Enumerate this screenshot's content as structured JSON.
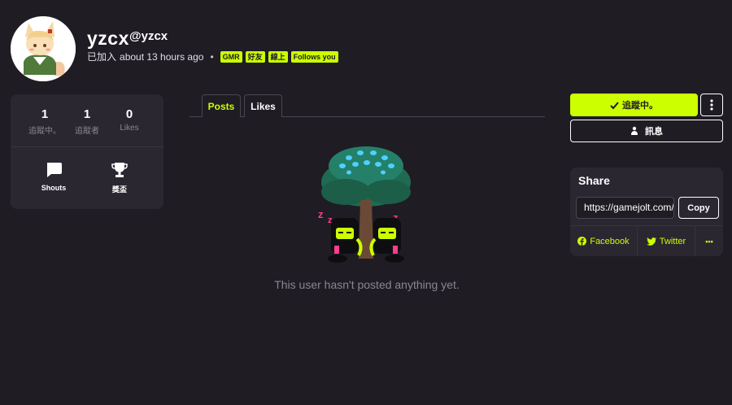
{
  "profile": {
    "name": "yzcx",
    "handle": "@yzcx",
    "joined_label": "已加入",
    "joined_time": "about 13 hours ago",
    "separator": "•",
    "tags": [
      "GMR",
      "好友",
      "線上",
      "Follows you"
    ]
  },
  "stats": {
    "items": [
      {
        "value": "1",
        "label": "追蹤中。"
      },
      {
        "value": "1",
        "label": "追蹤者"
      },
      {
        "value": "0",
        "label": "Likes"
      }
    ],
    "links": [
      {
        "label": "Shouts",
        "icon": "chat-bubble-icon"
      },
      {
        "label": "獎盃",
        "icon": "trophy-icon"
      }
    ]
  },
  "tabs": [
    {
      "label": "Posts",
      "active": true
    },
    {
      "label": "Likes",
      "active": false
    }
  ],
  "feed": {
    "empty_message": "This user hasn't posted anything yet."
  },
  "actions": {
    "follow_label": "追蹤中。",
    "follow_icon": "check-icon",
    "more_icon": "vertical-ellipsis-icon",
    "message_label": "訊息",
    "message_icon": "chat-user-icon"
  },
  "share": {
    "title": "Share",
    "url": "https://gamejolt.com/@yzcx",
    "copy_label": "Copy",
    "facebook_label": "Facebook",
    "twitter_label": "Twitter",
    "more_label": "•••"
  },
  "colors": {
    "background": "#1f1c24",
    "card": "#2a2730",
    "accent": "#ccff00",
    "muted": "#8a8691"
  }
}
